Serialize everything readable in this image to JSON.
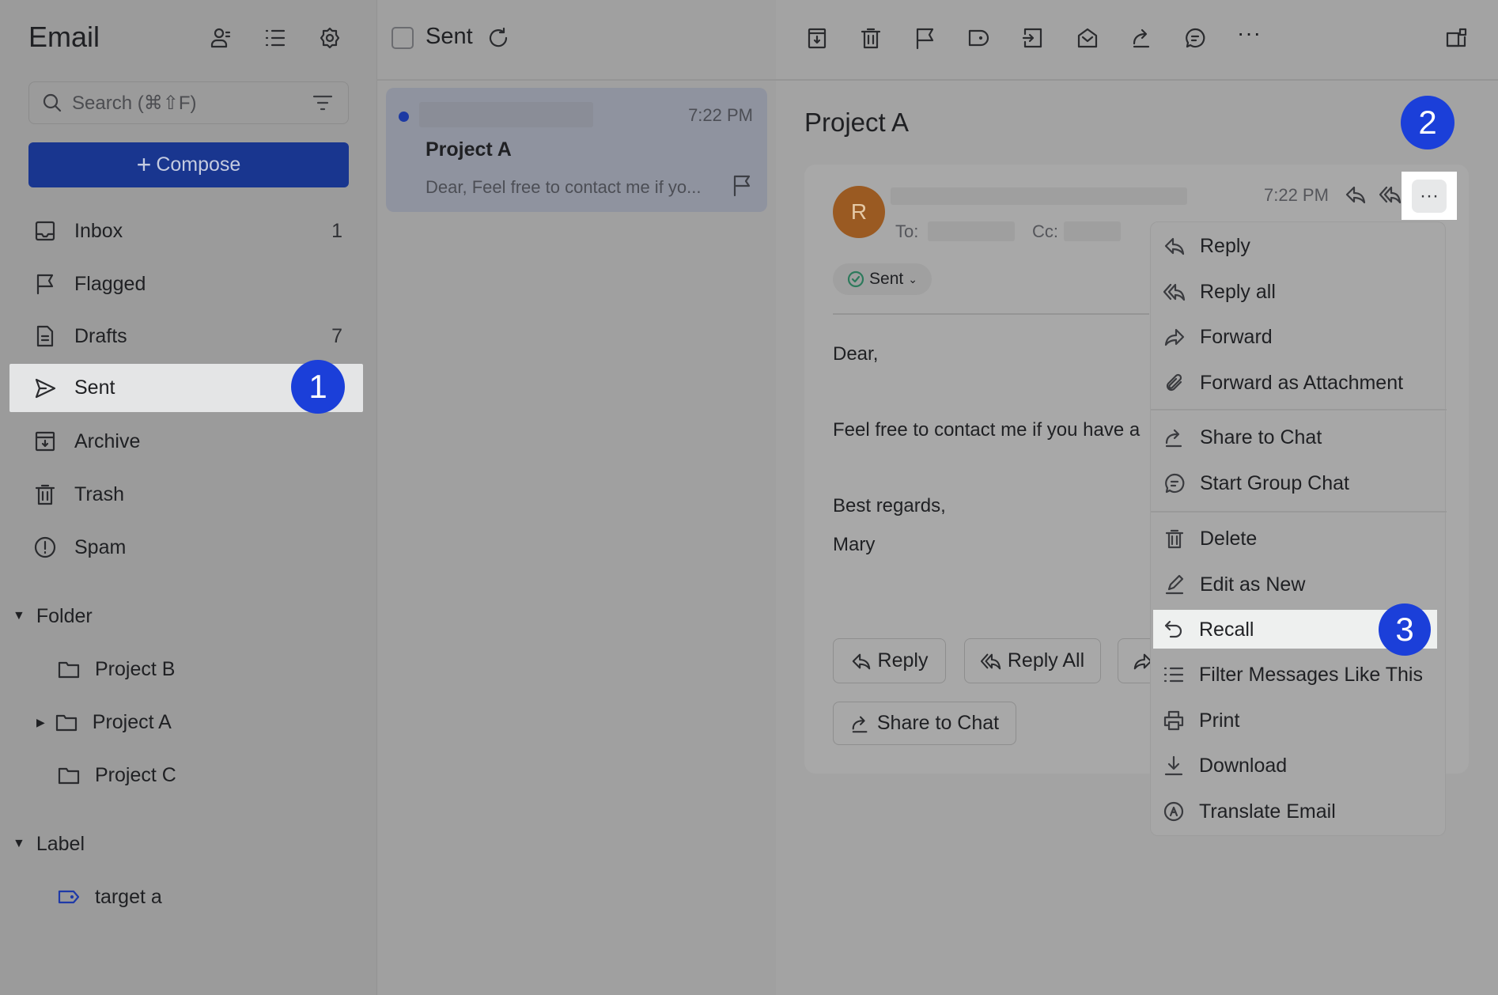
{
  "app": {
    "title": "Email"
  },
  "search": {
    "placeholder": "Search (⌘⇧F)"
  },
  "compose_label": "Compose",
  "nav": [
    {
      "label": "Inbox",
      "count": "1",
      "icon": "inbox-icon"
    },
    {
      "label": "Flagged",
      "count": "",
      "icon": "flag-icon"
    },
    {
      "label": "Drafts",
      "count": "7",
      "icon": "draft-icon"
    },
    {
      "label": "Sent",
      "count": "",
      "icon": "send-icon"
    },
    {
      "label": "Archive",
      "count": "",
      "icon": "archive-icon"
    },
    {
      "label": "Trash",
      "count": "",
      "icon": "trash-icon"
    },
    {
      "label": "Spam",
      "count": "",
      "icon": "spam-icon"
    }
  ],
  "folder": {
    "label": "Folder",
    "items": [
      "Project B",
      "Project A",
      "Project C"
    ]
  },
  "label": {
    "label": "Label",
    "items": [
      "target a"
    ]
  },
  "list": {
    "folder_title": "Sent",
    "item": {
      "time": "7:22 PM",
      "subject": "Project A",
      "preview": "Dear, Feel free to contact me if yo..."
    }
  },
  "reader": {
    "subject": "Project A",
    "avatar_letter": "R",
    "time": "7:22 PM",
    "to_label": "To:",
    "cc_label": "Cc:",
    "status": "Sent",
    "body": [
      "Dear,",
      "Feel free to contact me if you have a",
      "Best regards,",
      "Mary"
    ],
    "buttons": [
      "Reply",
      "Reply All",
      "Share to Chat"
    ]
  },
  "menu": [
    "Reply",
    "Reply all",
    "Forward",
    "Forward as Attachment",
    "Share to Chat",
    "Start Group Chat",
    "Delete",
    "Edit as New",
    "Recall",
    "Filter Messages Like This",
    "Print",
    "Download",
    "Translate Email"
  ],
  "badges": [
    "1",
    "2",
    "3"
  ],
  "colors": {
    "accent": "#1b3fd9",
    "compose": "#19368f",
    "avatar": "#9a5a22"
  }
}
